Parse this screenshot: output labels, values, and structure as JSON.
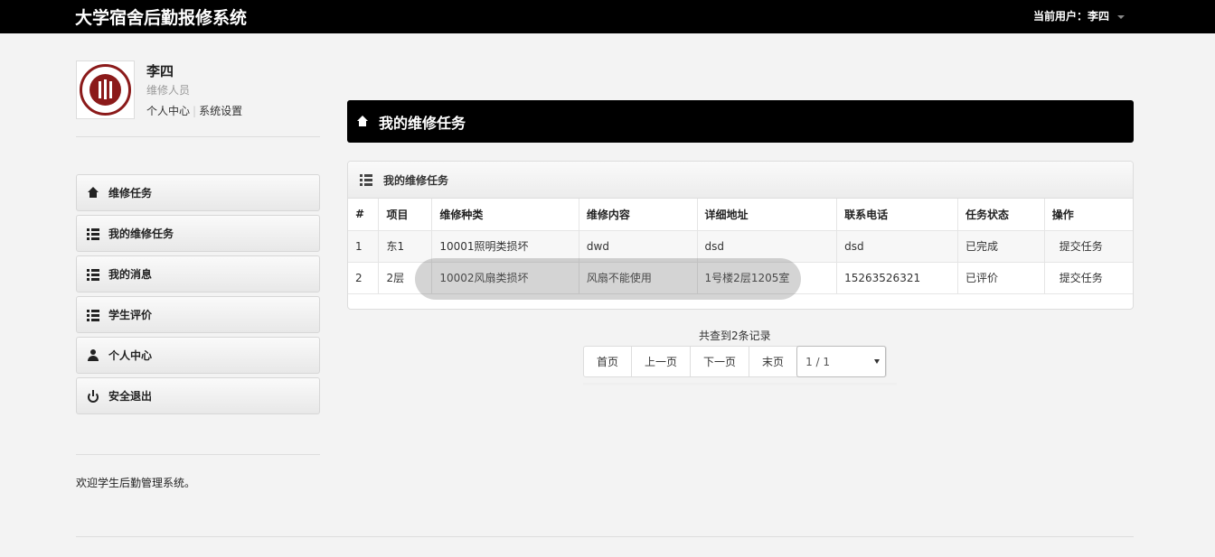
{
  "app": {
    "title": "大学宿舍后勤报修系统",
    "current_user_label": "当前用户：李四"
  },
  "profile": {
    "name": "李四",
    "role": "维修人员",
    "links": [
      "个人中心",
      "系统设置"
    ]
  },
  "sidebar": {
    "items": [
      {
        "label": "维修任务",
        "icon": "home-icon"
      },
      {
        "label": "我的维修任务",
        "icon": "list-icon"
      },
      {
        "label": "我的消息",
        "icon": "list-icon"
      },
      {
        "label": "学生评价",
        "icon": "list-icon"
      },
      {
        "label": "个人中心",
        "icon": "user-icon"
      },
      {
        "label": "安全退出",
        "icon": "power-icon"
      }
    ],
    "welcome": "欢迎学生后勤管理系统。"
  },
  "main": {
    "header_title": "我的维修任务",
    "panel_title": "我的维修任务",
    "table": {
      "columns": [
        "#",
        "项目",
        "维修种类",
        "维修内容",
        "详细地址",
        "联系电话",
        "任务状态",
        "操作"
      ],
      "rows": [
        [
          "1",
          "东1",
          "10001照明类损坏",
          "dwd",
          "dsd",
          "dsd",
          "已完成",
          "提交任务"
        ],
        [
          "2",
          "2层",
          "10002风扇类损坏",
          "风扇不能使用",
          "1号楼2层1205室",
          "15263526321",
          "已评价",
          "提交任务"
        ]
      ]
    },
    "pagination": {
      "summary": "共查到2条记录",
      "buttons": [
        "首页",
        "上一页",
        "下一页",
        "末页"
      ],
      "page_select": "1 / 1"
    }
  },
  "colors": {
    "topbar": "#000000",
    "seal": "#8b1a1a"
  }
}
